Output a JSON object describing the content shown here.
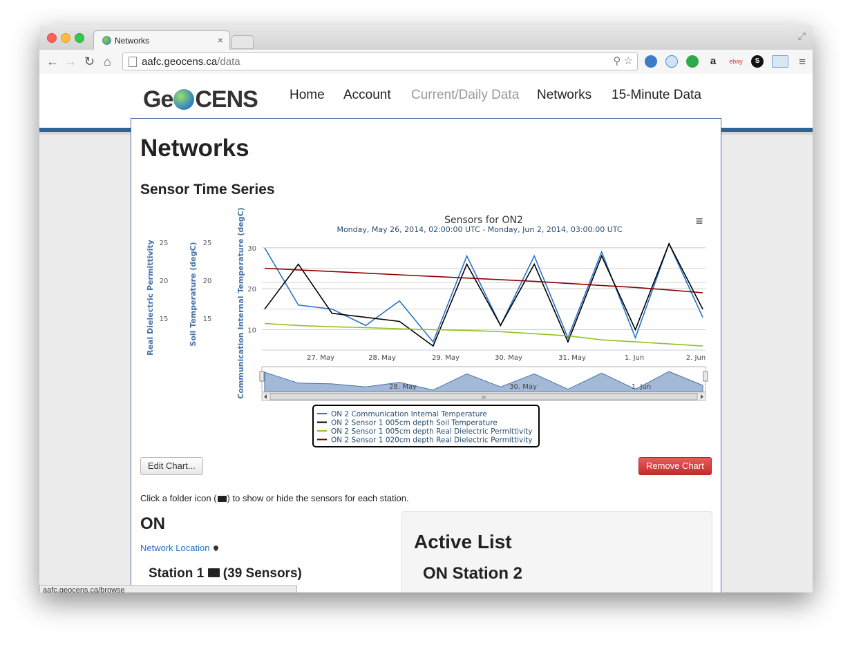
{
  "browser": {
    "tab_title": "Networks",
    "tab_close": "×",
    "url_host": "aafc.geocens.ca",
    "url_path": "/data",
    "status_url": "aafc.geocens.ca/browse",
    "nav": {
      "back": "←",
      "forward": "→",
      "reload": "↻",
      "home": "⌂"
    },
    "omnibox_icons": "⚲ ☆",
    "extensions": [
      "globe-extension",
      "target-extension",
      "hangouts-extension",
      "amazon-extension",
      "ebay-extension",
      "s-extension",
      "window-extension"
    ],
    "ext_labels": {
      "amazon": "a",
      "ebay": "ebay",
      "s": "S"
    },
    "menu_glyph": "≡",
    "fullscreen_glyph": "⤢"
  },
  "site": {
    "logo_left": "Ge",
    "logo_right": "CENS",
    "nav_items": [
      "Home",
      "Account",
      "Current/Daily Data",
      "Networks",
      "15-Minute Data"
    ],
    "active_nav": "Current/Daily Data"
  },
  "page": {
    "title": "Networks",
    "section_title": "Sensor Time Series",
    "edit_button": "Edit Chart...",
    "remove_button": "Remove Chart",
    "help_pre": "Click a folder icon (",
    "help_post": ") to show or hide the sensors for each station.",
    "network_name": "ON",
    "network_location": "Network Location",
    "station_name": "Station 1",
    "station_sensors": "(39 Sensors)",
    "active_list_title": "Active List",
    "active_list_items": [
      "ON Station 2"
    ]
  },
  "chart_data": {
    "type": "line",
    "title": "Sensors for ON2",
    "subtitle": "Monday, May 26, 2014, 02:00:00 UTC - Monday, Jun 2, 2014, 03:00:00 UTC",
    "x_ticks": [
      "27. May",
      "28. May",
      "29. May",
      "30. May",
      "31. May",
      "1. Jun",
      "2. Jun"
    ],
    "navigator_ticks": [
      "28. May",
      "30. May",
      "1. Jun"
    ],
    "navigator_scroll_glyph": "III",
    "menu_glyph": "≡",
    "y_axes": [
      {
        "label": "Real Dielectric Permittivity",
        "ticks": [
          25,
          20,
          15
        ]
      },
      {
        "label": "Soil Temperature (degC)",
        "ticks": [
          25,
          20,
          15
        ]
      },
      {
        "label": "Communication Internal Temperature (degC)",
        "ticks": [
          30,
          20,
          10
        ],
        "ylim": [
          5,
          32
        ]
      }
    ],
    "x": [
      "May 26 12:00",
      "May 27 00:00",
      "May 27 12:00",
      "May 28 00:00",
      "May 28 12:00",
      "May 29 00:00",
      "May 29 12:00",
      "May 30 00:00",
      "May 30 12:00",
      "May 31 00:00",
      "May 31 12:00",
      "Jun 1 00:00",
      "Jun 1 12:00",
      "Jun 2 00:00"
    ],
    "series": [
      {
        "name": "ON 2 Communication Internal Temperature",
        "color": "#2b73c6",
        "values": [
          30,
          16,
          15,
          11,
          17,
          7,
          28,
          11,
          28,
          8,
          29,
          8,
          31,
          13
        ]
      },
      {
        "name": "ON 2 Sensor 1 005cm depth Soil Temperature",
        "color": "#000000",
        "values": [
          15,
          26,
          14,
          13,
          12,
          6,
          26,
          11,
          26,
          7,
          28,
          10,
          31,
          15
        ]
      },
      {
        "name": "ON 2 Sensor 1 005cm depth Real Dielectric Permittivity",
        "color": "#8fc31f",
        "values": [
          11.5,
          11,
          10.7,
          10.5,
          10.2,
          10,
          9.8,
          9.5,
          9,
          8.5,
          7.5,
          7,
          6.5,
          6
        ]
      },
      {
        "name": "ON 2 Sensor 1 020cm depth Real Dielectric Permittivity",
        "color": "#8b0000",
        "values": [
          25,
          24.6,
          24.2,
          23.8,
          23.4,
          23,
          22.6,
          22.2,
          21.8,
          21.3,
          20.8,
          20.3,
          19.7,
          19
        ]
      }
    ]
  }
}
